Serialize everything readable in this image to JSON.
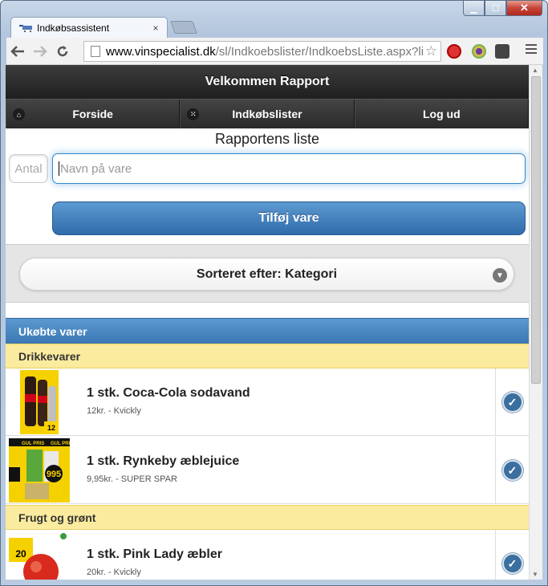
{
  "browser": {
    "tab_title": "Indkøbsassistent",
    "tab_close": "×",
    "url_host": "www.vinspecialist.dk",
    "url_path": "/sl/Indkoebslister/IndkoebsListe.aspx?li",
    "back_icon": "back-arrow-icon",
    "forward_icon": "forward-arrow-icon",
    "reload_icon": "reload-icon"
  },
  "app": {
    "header": "Velkommen Rapport",
    "nav": [
      {
        "label": "Forside",
        "icon": "home-icon"
      },
      {
        "label": "Indkøbslister",
        "icon": "grid-icon"
      },
      {
        "label": "Log ud",
        "icon": ""
      }
    ],
    "list_title": "Rapportens liste",
    "qty_placeholder": "Antal",
    "name_placeholder": "Navn på vare",
    "add_button": "Tilføj vare",
    "sort_label": "Sorteret efter: Kategori",
    "section_unbought": "Ukøbte varer",
    "categories": [
      {
        "name": "Drikkevarer",
        "items": [
          {
            "title": "1 stk. Coca-Cola sodavand",
            "price": "12kr.",
            "store": "Kvickly",
            "sub": "12kr. - Kvickly"
          },
          {
            "title": "1 stk. Rynkeby æblejuice",
            "price": "9,95kr.",
            "store": "SUPER SPAR",
            "sub": "9,95kr. - SUPER SPAR"
          }
        ]
      },
      {
        "name": "Frugt og grønt",
        "items": [
          {
            "title": "1 stk. Pink Lady æbler",
            "price": "20kr.",
            "store": "Kvickly",
            "sub": "20kr. - Kvickly"
          }
        ]
      }
    ]
  },
  "colors": {
    "header_bg": "#2b2b2b",
    "button_blue": "#3a78b5",
    "category_yellow": "#fbeb9e",
    "check_blue": "#3a6f9f"
  }
}
